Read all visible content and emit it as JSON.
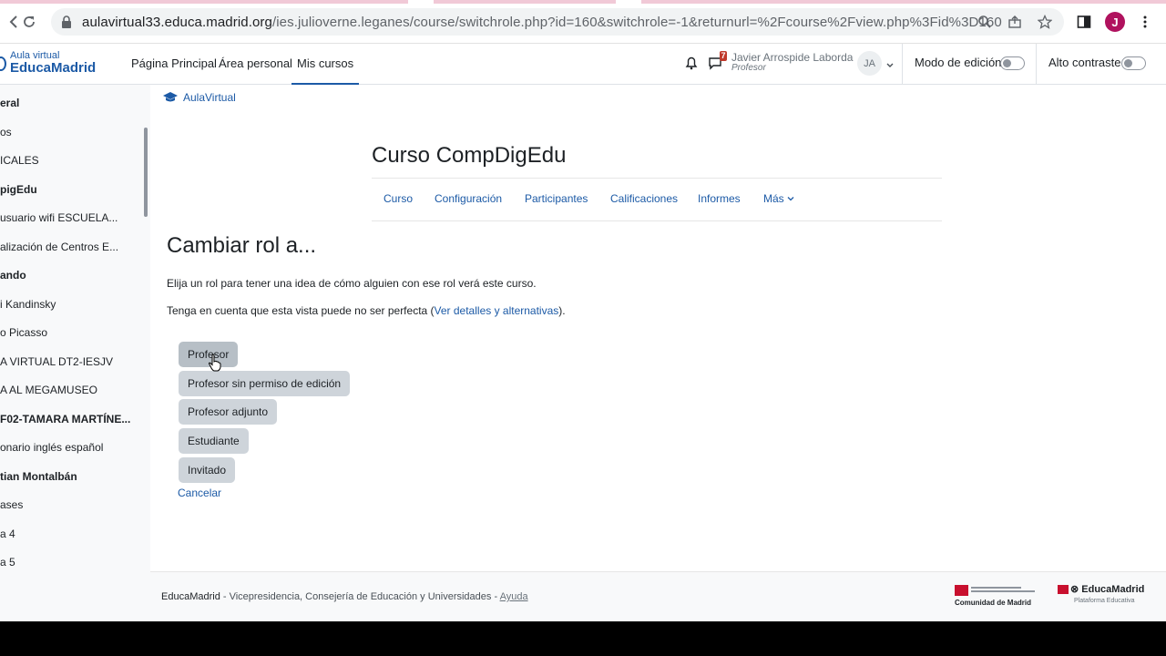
{
  "browser": {
    "url_host": "aulavirtual33.educa.madrid.org",
    "url_path": "/ies.julioverne.leganes/course/switchrole.php?id=160&switchrole=-1&returnurl=%2Fcourse%2Fview.php%3Fid%3D160",
    "profile_initial": "J",
    "icons": [
      "back-arrow-icon",
      "reload-icon",
      "lock-icon",
      "zoom-icon",
      "share-icon",
      "star-icon",
      "sidebar-icon",
      "menu-icon"
    ]
  },
  "header": {
    "logo_small": "Aula virtual",
    "logo_big": "EducaMadrid",
    "nav": [
      "Página Principal",
      "Área personal",
      "Mis cursos"
    ],
    "active_nav": "Mis cursos",
    "message_badge": "7",
    "user_name": "Javier Arrospide Laborda",
    "user_role": "Profesor",
    "avatar_initials": "JA",
    "edit_mode_label": "Modo de edición",
    "high_contrast_label": "Alto contraste"
  },
  "drawer": {
    "items": [
      {
        "label": "eral",
        "bold": true
      },
      {
        "label": "os",
        "bold": false
      },
      {
        "label": "ICALES",
        "bold": false
      },
      {
        "label": "pigEdu",
        "bold": true
      },
      {
        "label": " usuario wifi ESCUELA...",
        "bold": false
      },
      {
        "label": "alización de Centros E...",
        "bold": false
      },
      {
        "label": "ando",
        "bold": true
      },
      {
        "label": "i Kandinsky",
        "bold": false
      },
      {
        "label": "o Picasso",
        "bold": false
      },
      {
        "label": "A VIRTUAL DT2-IESJV",
        "bold": false
      },
      {
        "label": "A AL MEGAMUSEO",
        "bold": false
      },
      {
        "label": "F02-TAMARA MARTÍNE...",
        "bold": true
      },
      {
        "label": "onario inglés español",
        "bold": false
      },
      {
        "label": "tian Montalbán",
        "bold": true
      },
      {
        "label": "ases",
        "bold": false
      },
      {
        "label": "a 4",
        "bold": false
      },
      {
        "label": "a 5",
        "bold": false
      }
    ]
  },
  "breadcrumb": "AulaVirtual",
  "course": {
    "title": "Curso CompDigEdu",
    "tabs": [
      "Curso",
      "Configuración",
      "Participantes",
      "Calificaciones",
      "Informes",
      "Más"
    ]
  },
  "main": {
    "heading": "Cambiar rol a...",
    "para1": "Elija un rol para tener una idea de cómo alguien con ese rol verá este curso.",
    "para2_before": "Tenga en cuenta que esta vista puede no ser perfecta (",
    "para2_link": "Ver detalles y alternativas",
    "para2_after": ").",
    "roles": [
      "Profesor",
      "Profesor sin permiso de edición",
      "Profesor adjunto",
      "Estudiante",
      "Invitado"
    ],
    "cancel": "Cancelar"
  },
  "footer": {
    "brand": "EducaMadrid",
    "text": " - Vicepresidencia, Consejería de Educación y Universidades - ",
    "help": "Ayuda",
    "logo1_text": "Comunidad de Madrid",
    "logo2_text": "EducaMadrid",
    "logo2_sub": "Plataforma Educativa"
  }
}
